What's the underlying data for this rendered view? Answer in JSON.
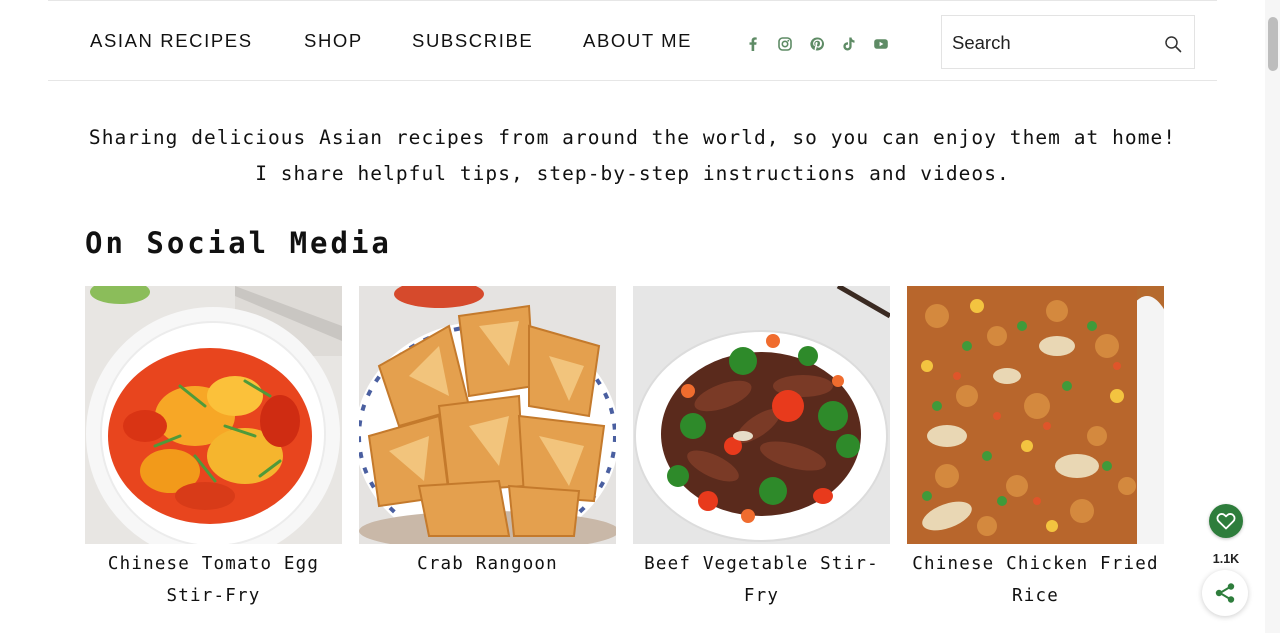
{
  "nav": {
    "items": [
      {
        "label": "ASIAN RECIPES"
      },
      {
        "label": "SHOP"
      },
      {
        "label": "SUBSCRIBE"
      },
      {
        "label": "ABOUT ME"
      }
    ],
    "social_icons": [
      "facebook-icon",
      "instagram-icon",
      "pinterest-icon",
      "tiktok-icon",
      "youtube-icon"
    ],
    "icon_color": "#5e8b65"
  },
  "search": {
    "placeholder": "Search",
    "icon": "search-icon"
  },
  "tagline": {
    "line1": "Sharing delicious Asian recipes from around the world, so you can enjoy them at home!",
    "line2": "I share helpful tips, step-by-step instructions and videos."
  },
  "social_section": {
    "title": "On Social Media",
    "cards": [
      {
        "title": "Chinese Tomato Egg Stir-Fry"
      },
      {
        "title": "Crab Rangoon"
      },
      {
        "title": "Beef Vegetable Stir-Fry"
      },
      {
        "title": "Chinese Chicken Fried Rice"
      }
    ]
  },
  "share": {
    "count": "1.1K",
    "heart_icon": "heart-icon",
    "share_icon": "share-icon",
    "accent": "#2e7d3c"
  }
}
